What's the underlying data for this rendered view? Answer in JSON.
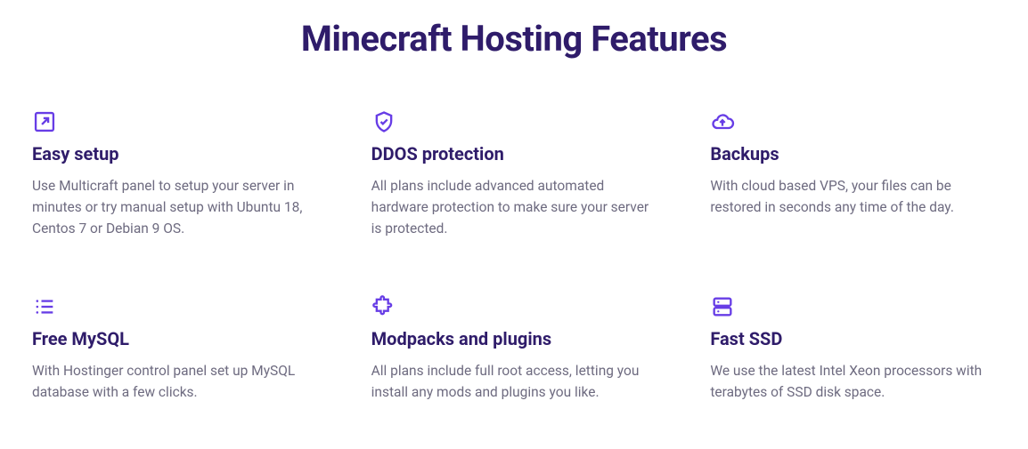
{
  "title": "Minecraft Hosting Features",
  "features": [
    {
      "title": "Easy setup",
      "desc": "Use Multicraft panel to setup your server in minutes or try manual setup with Ubuntu 18, Centos 7 or Debian 9 OS."
    },
    {
      "title": "DDOS protection",
      "desc": "All plans include advanced automated hardware protection to make sure your server is protected."
    },
    {
      "title": "Backups",
      "desc": "With cloud based VPS, your files can be restored in seconds any time of the day."
    },
    {
      "title": "Free MySQL",
      "desc": "With Hostinger control panel set up MySQL database with a few clicks."
    },
    {
      "title": "Modpacks and plugins",
      "desc": "All plans include full root access, letting you install any mods and plugins you like."
    },
    {
      "title": "Fast SSD",
      "desc": "We use the latest Intel Xeon processors with terabytes of SSD disk space."
    }
  ]
}
